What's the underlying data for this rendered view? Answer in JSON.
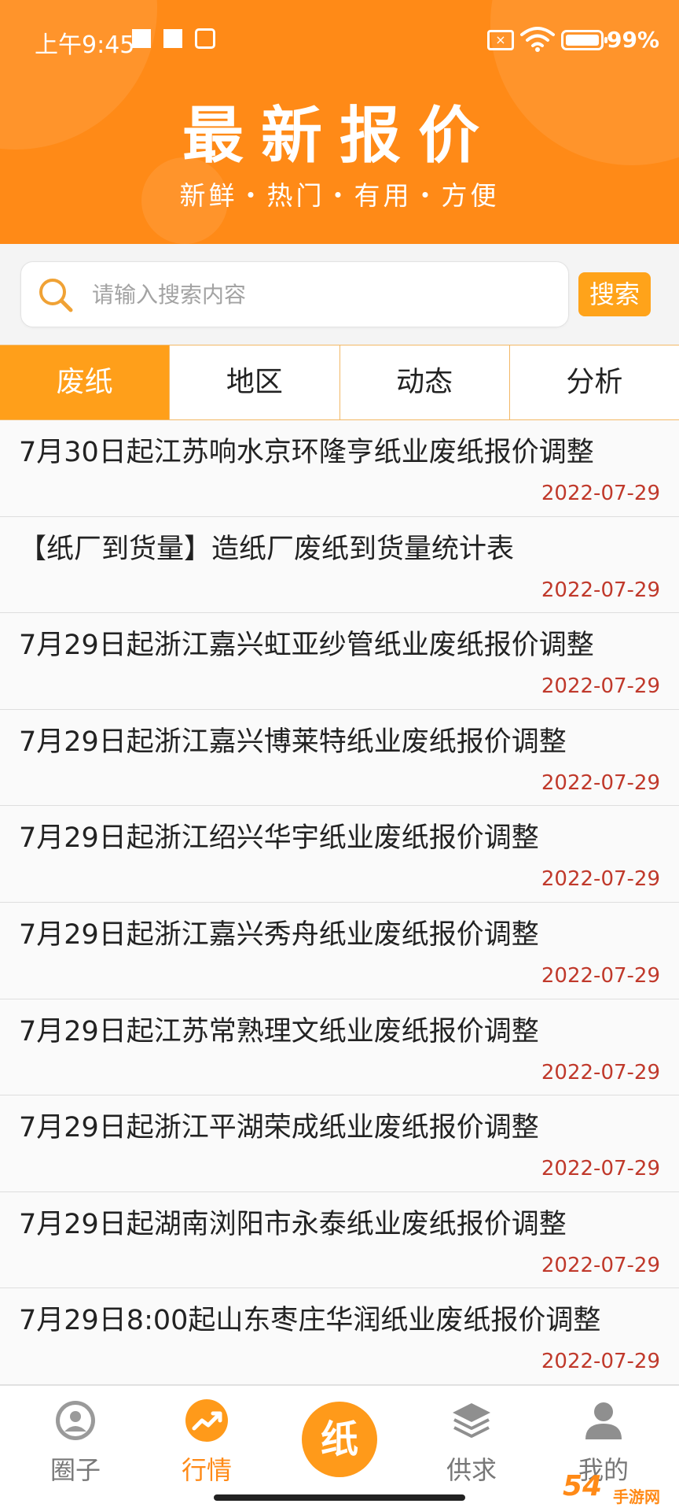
{
  "status_bar": {
    "time": "上午9:45",
    "battery": "99%"
  },
  "header": {
    "title": "最新报价",
    "subtitle": "新鲜・热门・有用・方便"
  },
  "search": {
    "placeholder": "请输入搜索内容",
    "button_label": "搜索"
  },
  "tabs": [
    {
      "label": "废纸",
      "active": true
    },
    {
      "label": "地区",
      "active": false
    },
    {
      "label": "动态",
      "active": false
    },
    {
      "label": "分析",
      "active": false
    }
  ],
  "list": [
    {
      "title": "7月30日起江苏响水京环隆亨纸业废纸报价调整",
      "date": "2022-07-29"
    },
    {
      "title": "【纸厂到货量】造纸厂废纸到货量统计表",
      "date": "2022-07-29"
    },
    {
      "title": "7月29日起浙江嘉兴虹亚纱管纸业废纸报价调整",
      "date": "2022-07-29"
    },
    {
      "title": "7月29日起浙江嘉兴博莱特纸业废纸报价调整",
      "date": "2022-07-29"
    },
    {
      "title": "7月29日起浙江绍兴华宇纸业废纸报价调整",
      "date": "2022-07-29"
    },
    {
      "title": "7月29日起浙江嘉兴秀舟纸业废纸报价调整",
      "date": "2022-07-29"
    },
    {
      "title": "7月29日起江苏常熟理文纸业废纸报价调整",
      "date": "2022-07-29"
    },
    {
      "title": "7月29日起浙江平湖荣成纸业废纸报价调整",
      "date": "2022-07-29"
    },
    {
      "title": "7月29日起湖南浏阳市永泰纸业废纸报价调整",
      "date": "2022-07-29"
    },
    {
      "title": "7月29日8:00起山东枣庄华润纸业废纸报价调整",
      "date": "2022-07-29"
    }
  ],
  "bottom_nav": [
    {
      "label": "圈子",
      "icon": "person-circle-icon"
    },
    {
      "label": "行情",
      "icon": "trend-up-icon",
      "active": true
    },
    {
      "label": "纸",
      "icon": "paper-center-icon"
    },
    {
      "label": "供求",
      "icon": "layers-icon"
    },
    {
      "label": "我的",
      "icon": "profile-icon"
    }
  ],
  "watermark": {
    "text": "54",
    "site": "手游网"
  },
  "colors": {
    "accent": "#ff8a17",
    "date": "#c0392b",
    "tab_active": "#ff9f1a"
  }
}
